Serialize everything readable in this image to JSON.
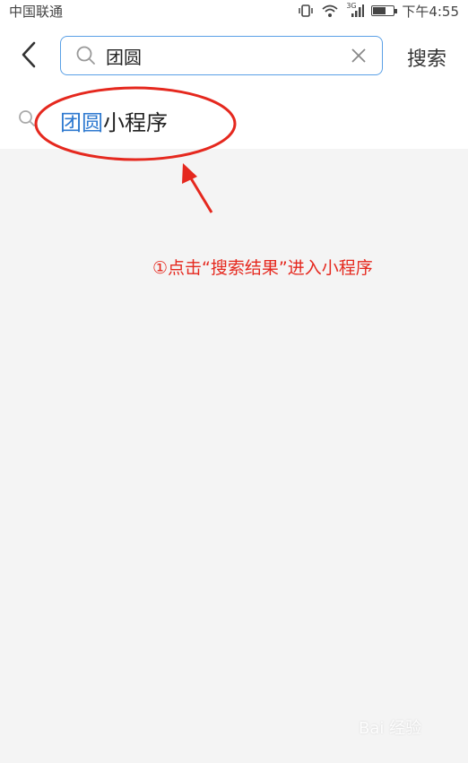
{
  "status_bar": {
    "carrier": "中国联通",
    "network": "3G",
    "time": "下午4:55",
    "battery_level_percent": 70
  },
  "header": {
    "search_query": "团圆",
    "search_button": "搜索"
  },
  "result": {
    "highlight": "团圆",
    "suffix": "小程序"
  },
  "annotation": {
    "text": "①点击“搜索结果”进入小程序",
    "color": "#e5281e"
  },
  "watermark": {
    "text": "Bai 经验"
  },
  "colors": {
    "accent": "#2f7ad0",
    "search_border": "#5aa0e6",
    "background": "#f4f4f4"
  }
}
